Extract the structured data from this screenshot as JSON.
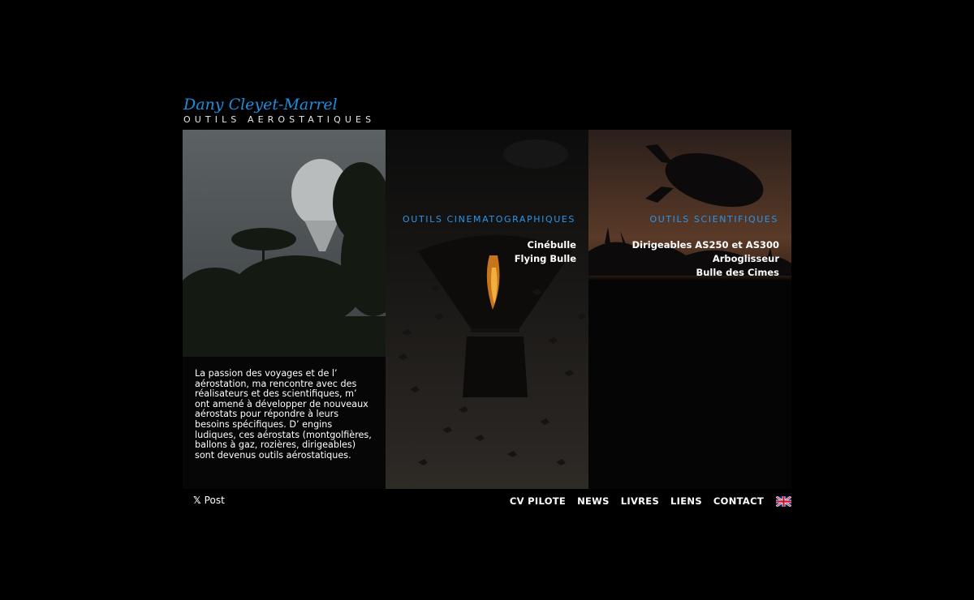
{
  "header": {
    "logo_name": "Dany Cleyet-Marrel",
    "logo_subtitle": "OUTILS AEROSTATIQUES"
  },
  "intro": {
    "text": "La passion des voyages et de l’ aérostation, ma rencontre avec des réalisateurs et des scientifiques, m’ ont amené à développer de nouveaux aérostats pour répondre à leurs besoins spécifiques. D’ engins ludiques, ces aérostats (montgolfières, ballons à gaz, rozières, dirigeables) sont devenus outils aérostatiques."
  },
  "cinema": {
    "title": "OUTILS CINEMATOGRAPHIQUES",
    "links": [
      "Cinébulle",
      "Flying Bulle"
    ]
  },
  "science": {
    "title": "OUTILS SCIENTIFIQUES",
    "links": [
      "Dirigeables AS250 et AS300",
      "Arboglisseur",
      "Bulle des Cimes"
    ]
  },
  "social": {
    "post_label": "Post"
  },
  "nav": {
    "items": [
      "CV PILOTE",
      "NEWS",
      "LIVRES",
      "LIENS",
      "CONTACT"
    ]
  },
  "icons": {
    "social": "x-logo-icon",
    "language": "uk-flag-icon"
  },
  "colors": {
    "accent": "#2d94e6",
    "background": "#000000"
  }
}
